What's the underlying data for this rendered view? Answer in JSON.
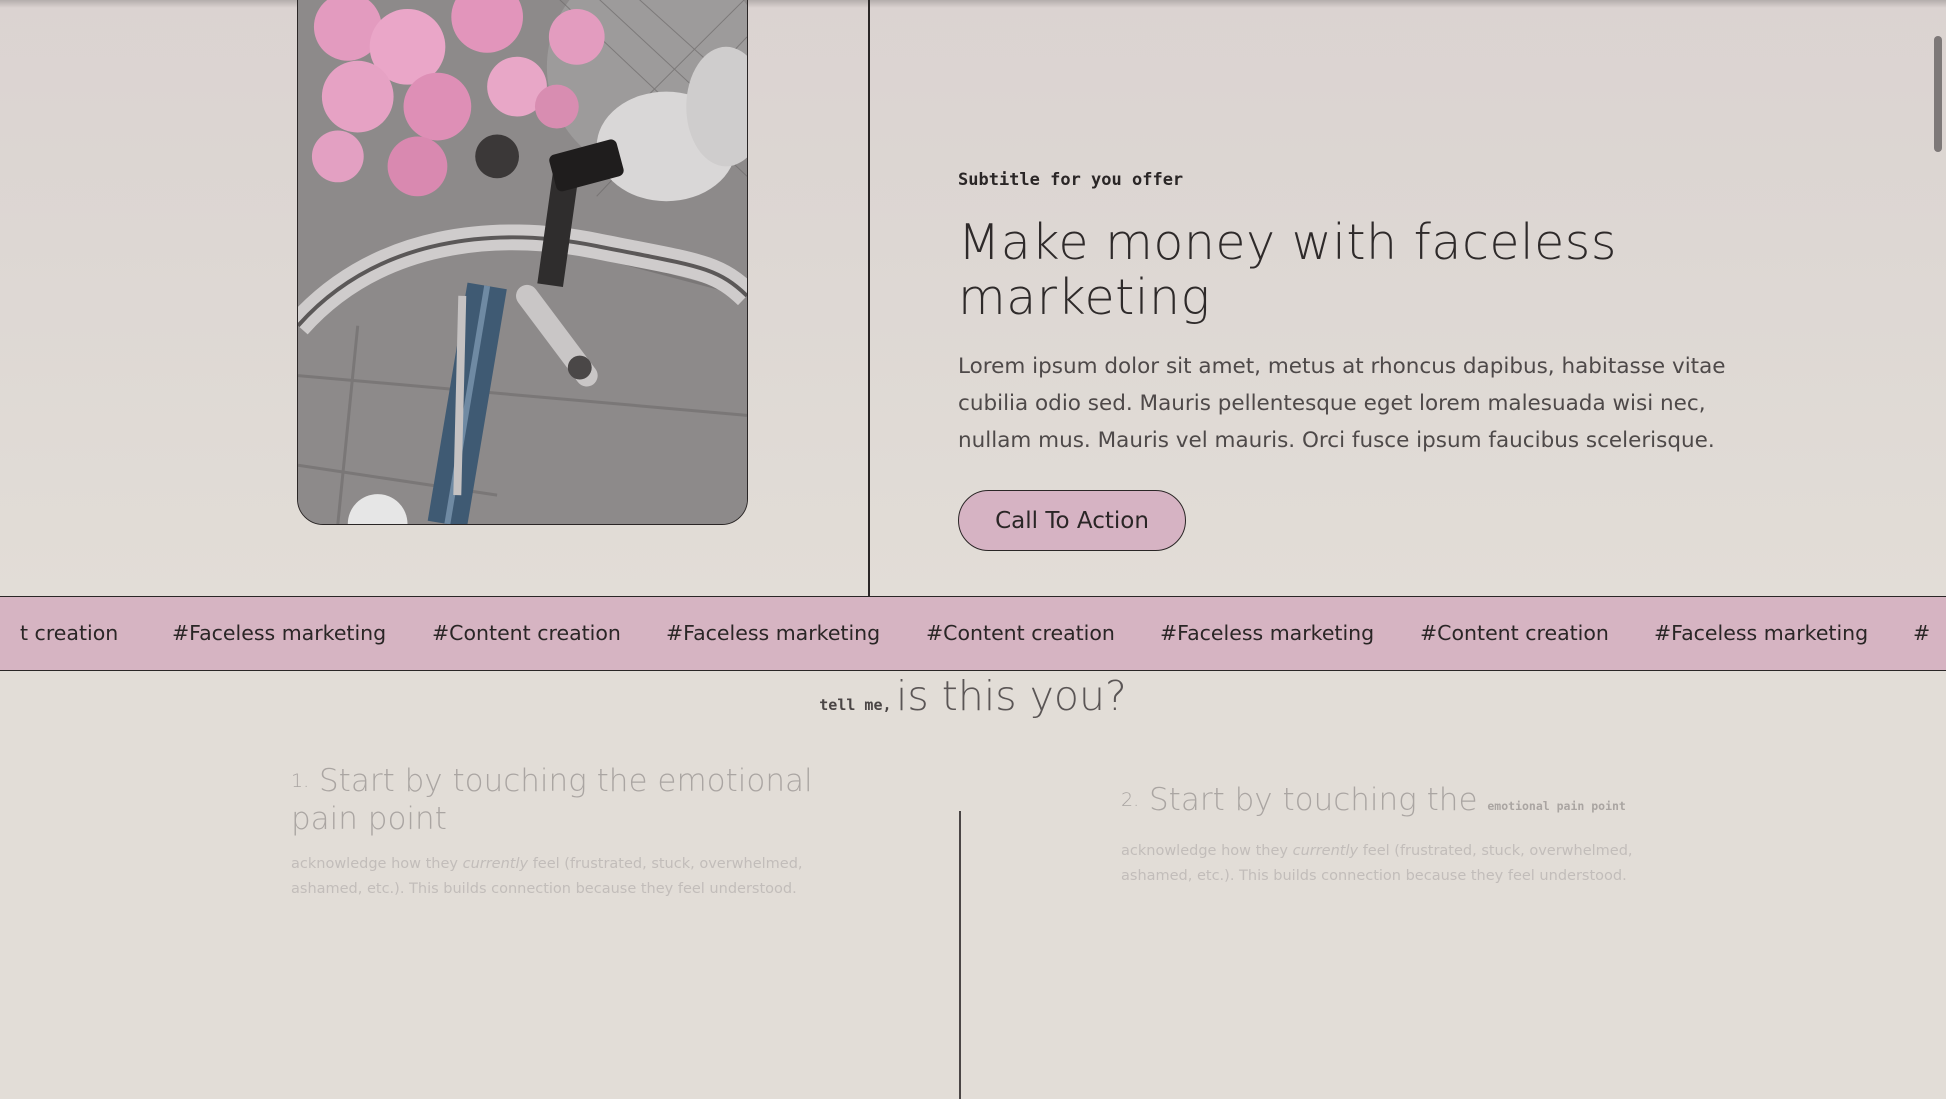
{
  "hero": {
    "subtitle": "Subtitle for you offer",
    "headline_line1": "Make money with faceless",
    "headline_line2": "marketing",
    "body_line1": "Lorem ipsum dolor sit amet, metus at rhoncus dapibus, habitasse vitae",
    "body_line2": "cubilia odio sed. Mauris pellentesque eget lorem malesuada wisi nec,",
    "body_line3": "nullam mus. Mauris vel mauris. Orci fusce ipsum faucibus scelerisque.",
    "cta_label": "Call To Action"
  },
  "marquee": {
    "tags": [
      "t creation",
      "#Faceless marketing",
      "#Content creation",
      "#Faceless marketing",
      "#Content creation",
      "#Faceless marketing",
      "#Content creation",
      "#Faceless marketing",
      "#"
    ]
  },
  "question": {
    "small": "tell me,",
    "big": "is this you?"
  },
  "items": [
    {
      "number": "1.",
      "title_line1": "Start by touching the emotional",
      "title_line2": "pain point",
      "desc_before": "acknowledge how they ",
      "desc_em": "currently",
      "desc_after1": " feel (frustrated, stuck, overwhelmed,",
      "desc_line2": "ashamed, etc.). This builds connection because they feel understood."
    },
    {
      "number": "2.",
      "title": "Start by touching the",
      "title_mini": "emotional pain point",
      "desc_before": "acknowledge how they ",
      "desc_em": "currently",
      "desc_after1": " feel (frustrated, stuck, overwhelmed,",
      "desc_line2": "ashamed, etc.). This builds connection because they feel understood."
    }
  ],
  "colors": {
    "background": "#e2ddd7",
    "accent_pink": "#d6b4c2",
    "ink": "#2a2626"
  }
}
